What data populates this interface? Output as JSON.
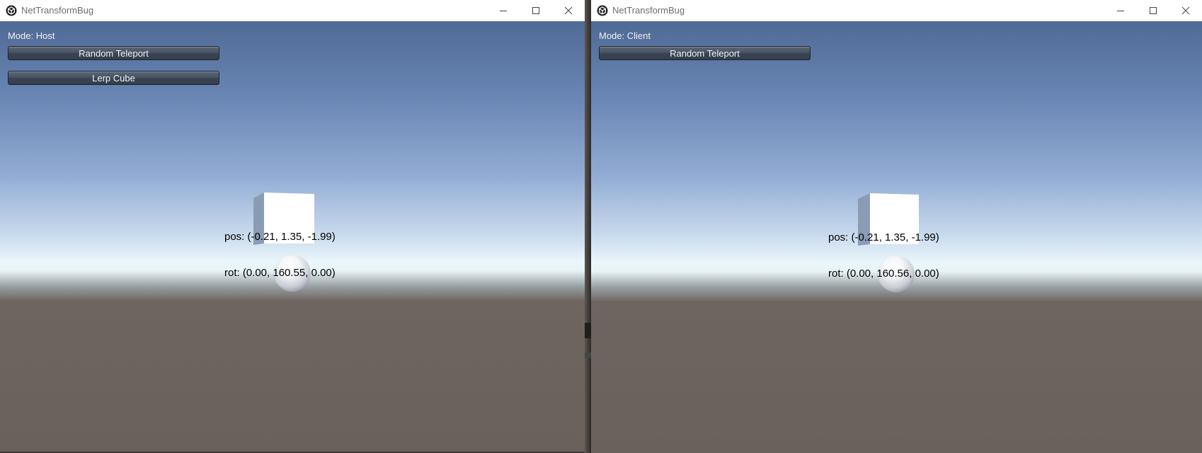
{
  "windows": [
    {
      "title": "NetTransformBug",
      "mode_label": "Mode: Host",
      "buttons": [
        "Random Teleport",
        "Lerp Cube"
      ],
      "readout": {
        "pos": "pos: (-0.21, 1.35, -1.99)",
        "rot": "rot: (0.00, 160.55, 0.00)"
      }
    },
    {
      "title": "NetTransformBug",
      "mode_label": "Mode: Client",
      "buttons": [
        "Random Teleport"
      ],
      "readout": {
        "pos": "pos: (-0.21, 1.35, -1.99)",
        "rot": "rot: (0.00, 160.56, 0.00)"
      }
    }
  ],
  "icons": {
    "app": "unity-logo-icon",
    "minimize": "minimize-icon",
    "maximize": "maximize-icon",
    "close": "close-icon"
  }
}
